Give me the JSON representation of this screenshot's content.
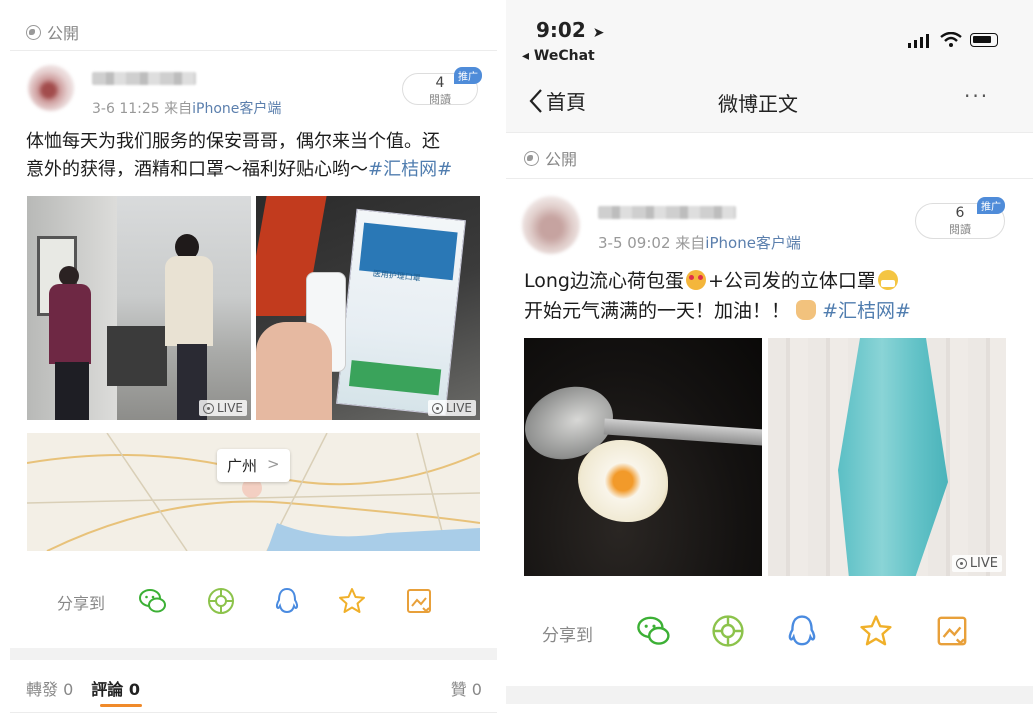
{
  "left": {
    "public_label": "公開",
    "post": {
      "meta_time": "3-6 11:25",
      "meta_from": "来自",
      "meta_source": "iPhone客户端",
      "read_count": "4",
      "read_label": "閱讀",
      "promo_badge": "推广",
      "text_line1": "体恤每天为我们服务的保安哥哥，偶尔来当个值。还",
      "text_line2": "意外的获得，酒精和口罩～福利好贴心哟～",
      "hashtag": "#汇桔网#",
      "live_label": "LIVE",
      "map_city": "广州",
      "map_arrow": ">",
      "mask_pack_text": "医用护理口罩"
    },
    "share": {
      "label": "分享到"
    },
    "tabs": {
      "repost": "轉發 0",
      "comment": "評論 0",
      "like": "贊 0"
    }
  },
  "right": {
    "status": {
      "time": "9:02",
      "back_app": "◂ WeChat"
    },
    "nav": {
      "back_label": "首頁",
      "title": "微博正文",
      "more": "···"
    },
    "public_label": "公開",
    "post": {
      "meta_time": "3-5 09:02",
      "meta_from": "来自",
      "meta_source": "iPhone客户端",
      "read_count": "6",
      "read_label": "閱讀",
      "promo_badge": "推广",
      "text_line1_a": "Long边流心荷包蛋",
      "text_line1_b": "+公司发的立体口罩",
      "text_line2": "开始元气满满的一天！加油！！",
      "hashtag": "#汇桔网#",
      "live_label": "LIVE"
    },
    "share": {
      "label": "分享到"
    }
  },
  "icons": {
    "wechat": "wechat-icon",
    "moments": "moments-icon",
    "qq": "qq-icon",
    "favorite": "star-icon",
    "save_image": "save-image-icon"
  },
  "colors": {
    "link_blue": "#507daf",
    "wechat_green": "#3cb035",
    "moments_green": "#8cc34b",
    "qq_blue": "#4a8be0",
    "star_yellow": "#f0b02a",
    "save_orange": "#e8a03a",
    "tab_active": "#f08a2a"
  }
}
